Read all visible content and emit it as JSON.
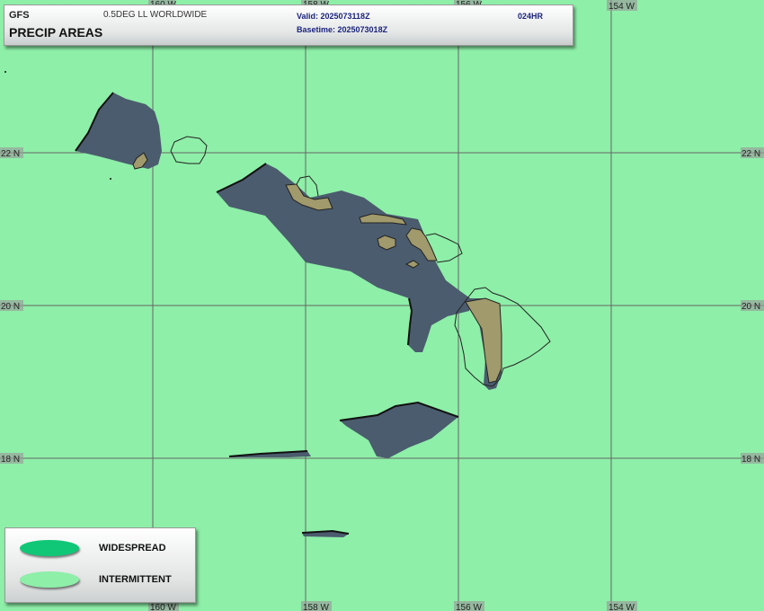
{
  "header": {
    "model": "GFS",
    "grid": "0.5DEG LL WORLDWIDE",
    "product": "PRECIP AREAS",
    "valid": "Valid: 2025073118Z",
    "basetime": "Basetime: 2025073018Z",
    "forecast_hour": "024HR"
  },
  "map": {
    "longitude_labels": [
      "160 W",
      "158 W",
      "156 W",
      "154 W"
    ],
    "latitude_labels": [
      "22 N",
      "20 N",
      "18 N"
    ]
  },
  "legend": {
    "items": [
      {
        "label": "WIDESPREAD",
        "color": "#10c777"
      },
      {
        "label": "INTERMITTENT",
        "color": "#8eefa8"
      }
    ]
  },
  "colors": {
    "background": "#8eefa8",
    "precip_area": "#4b5c6e",
    "land": "#a09a6c",
    "grid": "#666666"
  }
}
